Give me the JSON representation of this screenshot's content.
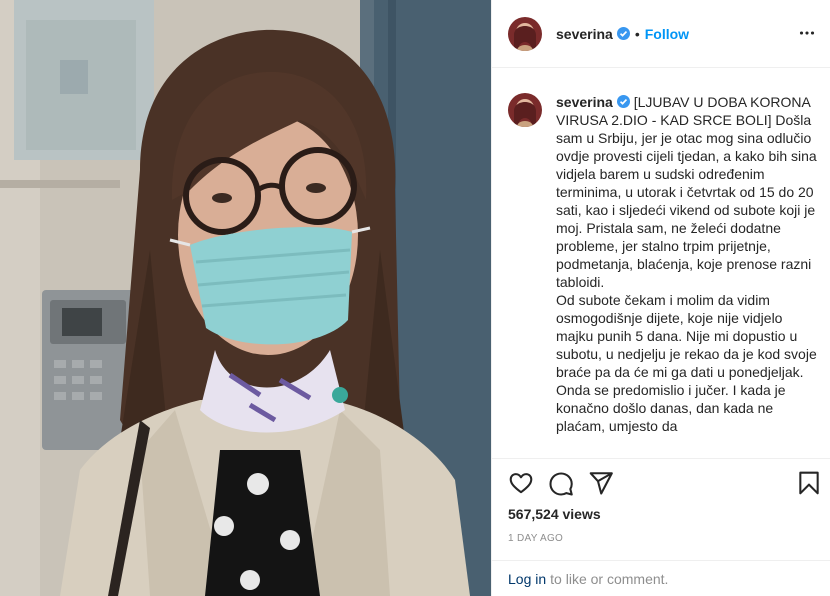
{
  "post": {
    "username": "severina",
    "follow_label": "Follow",
    "separator": "•",
    "caption": "[LJUBAV U DOBA KORONA VIRUSA 2.DIO - KAD SRCE BOLI] Došla sam u Srbiju, jer je otac mog sina odlučio ovdje provesti cijeli tjedan, a kako bih sina vidjela barem u sudski određenim terminima, u utorak i četvrtak od 15 do 20 sati, kao i sljedeći vikend od subote koji je moj. Pristala sam, ne želeći dodatne probleme, jer stalno trpim prijetnje, podmetanja, blaćenja, koje prenose razni tabloidi.\nOd subote čekam i molim da vidim osmogodišnje dijete, koje nije vidjelo majku punih 5 dana. Nije mi dopustio u subotu, u nedjelju je rekao da je kod svoje braće pa da će mi ga dati u ponedjeljak. Onda se predomislio i jučer. I kada je konačno došlo danas, dan kada ne plaćam, umjesto da",
    "views": "567,524 views",
    "time_ago": "1 DAY AGO"
  },
  "footer": {
    "login_link": "Log in",
    "login_text": "to like or comment."
  },
  "icons": {
    "verified": "verified-badge-icon",
    "more": "more-options-icon",
    "like": "heart-icon",
    "comment": "comment-icon",
    "share": "paper-plane-icon",
    "save": "bookmark-icon"
  },
  "colors": {
    "accent": "#0095f6",
    "link": "#00376b",
    "muted": "#8e8e8e",
    "text": "#262626",
    "border": "#efefef"
  }
}
